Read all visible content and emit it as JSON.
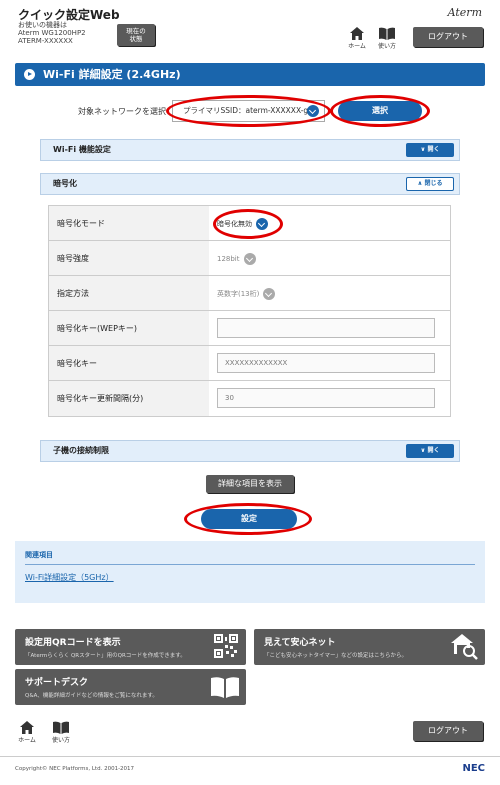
{
  "header": {
    "app_title": "クイック設定Web",
    "device_line1": "お使いの機器は",
    "device_line2": "Aterm WG1200HP2",
    "device_line3": "ATERM-XXXXXX",
    "status_label_1": "現在の",
    "status_label_2": "状態",
    "brand": "Aterm",
    "home_label": "ホーム",
    "help_label": "使い方",
    "logout_label": "ログアウト"
  },
  "page_title": "Wi-Fi 詳細設定 (2.4GHz)",
  "network": {
    "label": "対象ネットワークを選択",
    "selected": "プライマリSSID：aterm-XXXXXX-g",
    "select_button": "選択"
  },
  "sections": {
    "wifi_function": "Wi-Fi 機能設定",
    "encryption": "暗号化",
    "child_limit": "子機の接続制限",
    "open_label": "∨ 開く",
    "close_label": "∧ 閉じる"
  },
  "encryption_rows": {
    "mode_label": "暗号化モード",
    "mode_value": "暗号化無効",
    "strength_label": "暗号強度",
    "strength_value": "128bit",
    "method_label": "指定方法",
    "method_value": "英数字(13桁)",
    "wep_key_label": "暗号化キー(WEPキー)",
    "wep_key_value": "",
    "key_label": "暗号化キー",
    "key_value": "XXXXXXXXXXXXX",
    "interval_label": "暗号化キー更新間隔(分)",
    "interval_value": "30"
  },
  "detail_button": "詳細な項目を表示",
  "apply_button": "設定",
  "related": {
    "heading": "関連項目",
    "link": "Wi-Fi詳細設定（5GHz）"
  },
  "tiles": {
    "qr_title": "設定用QRコードを表示",
    "qr_desc": "「Atermらくらく QRスタート」用のQRコードを作成できます。",
    "safety_title": "見えて安心ネット",
    "safety_desc": "「こども安心ネットタイマー」などの設定はこちらから。",
    "support_title": "サポートデスク",
    "support_desc": "Q&A、機能詳細ガイドなどの情報をご覧になれます。"
  },
  "footer": {
    "home_label": "ホーム",
    "help_label": "使い方",
    "logout_label": "ログアウト",
    "copyright": "Copyright© NEC Platforms, Ltd. 2001-2017",
    "nec": "NEC"
  },
  "colors": {
    "primary_blue": "#1a65ac",
    "section_bg": "#e2eefa",
    "button_gray": "#5a5a5a",
    "highlight_red": "#e00000"
  }
}
